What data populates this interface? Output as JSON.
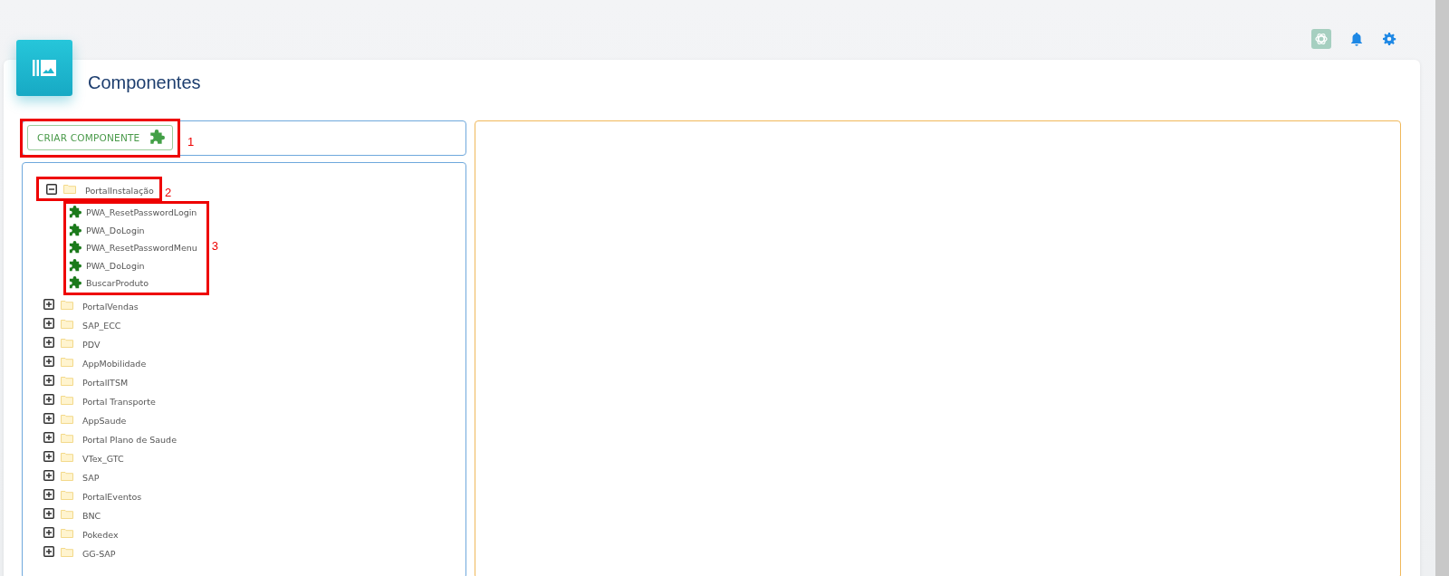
{
  "page": {
    "title": "Componentes"
  },
  "create_button": {
    "label": "CRIAR COMPONENTE"
  },
  "annotations": [
    {
      "label": "1"
    },
    {
      "label": "2"
    },
    {
      "label": "3"
    }
  ],
  "tree": [
    {
      "kind": "folder",
      "label": "PortalInstalação",
      "expanded": true,
      "children": [
        {
          "kind": "component",
          "label": "PWA_ResetPasswordLogin"
        },
        {
          "kind": "component",
          "label": "PWA_DoLogin"
        },
        {
          "kind": "component",
          "label": "PWA_ResetPasswordMenu"
        },
        {
          "kind": "component",
          "label": "PWA_DoLogin"
        },
        {
          "kind": "component",
          "label": "BuscarProduto"
        }
      ]
    },
    {
      "kind": "folder",
      "label": "PortalVendas",
      "expanded": false
    },
    {
      "kind": "folder",
      "label": "SAP_ECC",
      "expanded": false
    },
    {
      "kind": "folder",
      "label": "PDV",
      "expanded": false
    },
    {
      "kind": "folder",
      "label": "AppMobilidade",
      "expanded": false
    },
    {
      "kind": "folder",
      "label": "PortalITSM",
      "expanded": false
    },
    {
      "kind": "folder",
      "label": "Portal Transporte",
      "expanded": false
    },
    {
      "kind": "folder",
      "label": "AppSaude",
      "expanded": false
    },
    {
      "kind": "folder",
      "label": "Portal Plano de Saude",
      "expanded": false
    },
    {
      "kind": "folder",
      "label": "VTex_GTC",
      "expanded": false
    },
    {
      "kind": "folder",
      "label": "SAP",
      "expanded": false
    },
    {
      "kind": "folder",
      "label": "PortalEventos",
      "expanded": false
    },
    {
      "kind": "folder",
      "label": "BNC",
      "expanded": false
    },
    {
      "kind": "folder",
      "label": "Pokedex",
      "expanded": false
    },
    {
      "kind": "folder",
      "label": "GG-SAP",
      "expanded": false
    }
  ]
}
